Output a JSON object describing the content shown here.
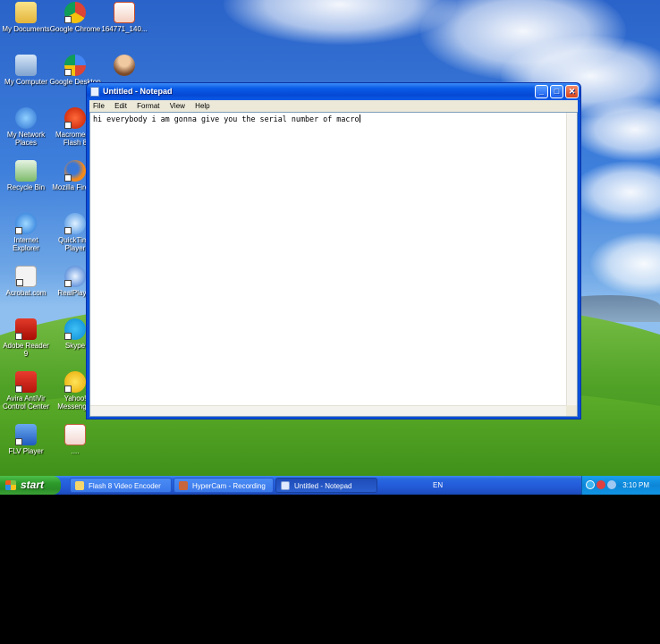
{
  "desktop": {
    "icons": [
      {
        "label": "My Documents"
      },
      {
        "label": "Google Chrome"
      },
      {
        "label": "164771_140..."
      },
      {
        "label": "My Computer"
      },
      {
        "label": "Google Desktop"
      },
      {
        "label": ""
      },
      {
        "label": "My Network Places"
      },
      {
        "label": "Macromedia Flash 8"
      },
      {
        "label": "Recycle Bin"
      },
      {
        "label": "Mozilla Firefox"
      },
      {
        "label": "Internet Explorer"
      },
      {
        "label": "QuickTime Player"
      },
      {
        "label": "Acrobat.com"
      },
      {
        "label": "RealPlayer"
      },
      {
        "label": "Adobe Reader 9"
      },
      {
        "label": "Skype"
      },
      {
        "label": "Avira AntiVir Control Center"
      },
      {
        "label": "Yahoo! Messenger"
      },
      {
        "label": "FLV Player"
      },
      {
        "label": "...."
      }
    ]
  },
  "notepad": {
    "title": "Untitled - Notepad",
    "menu": [
      "File",
      "Edit",
      "Format",
      "View",
      "Help"
    ],
    "text": "hi everybody i am gonna give you the serial number of macro"
  },
  "taskbar": {
    "start_label": "start",
    "tasks": [
      {
        "label": "Flash 8 Video Encoder"
      },
      {
        "label": "HyperCam - Recording"
      },
      {
        "label": "Untitled - Notepad"
      }
    ],
    "language": "EN",
    "clock": "3:10 PM"
  }
}
